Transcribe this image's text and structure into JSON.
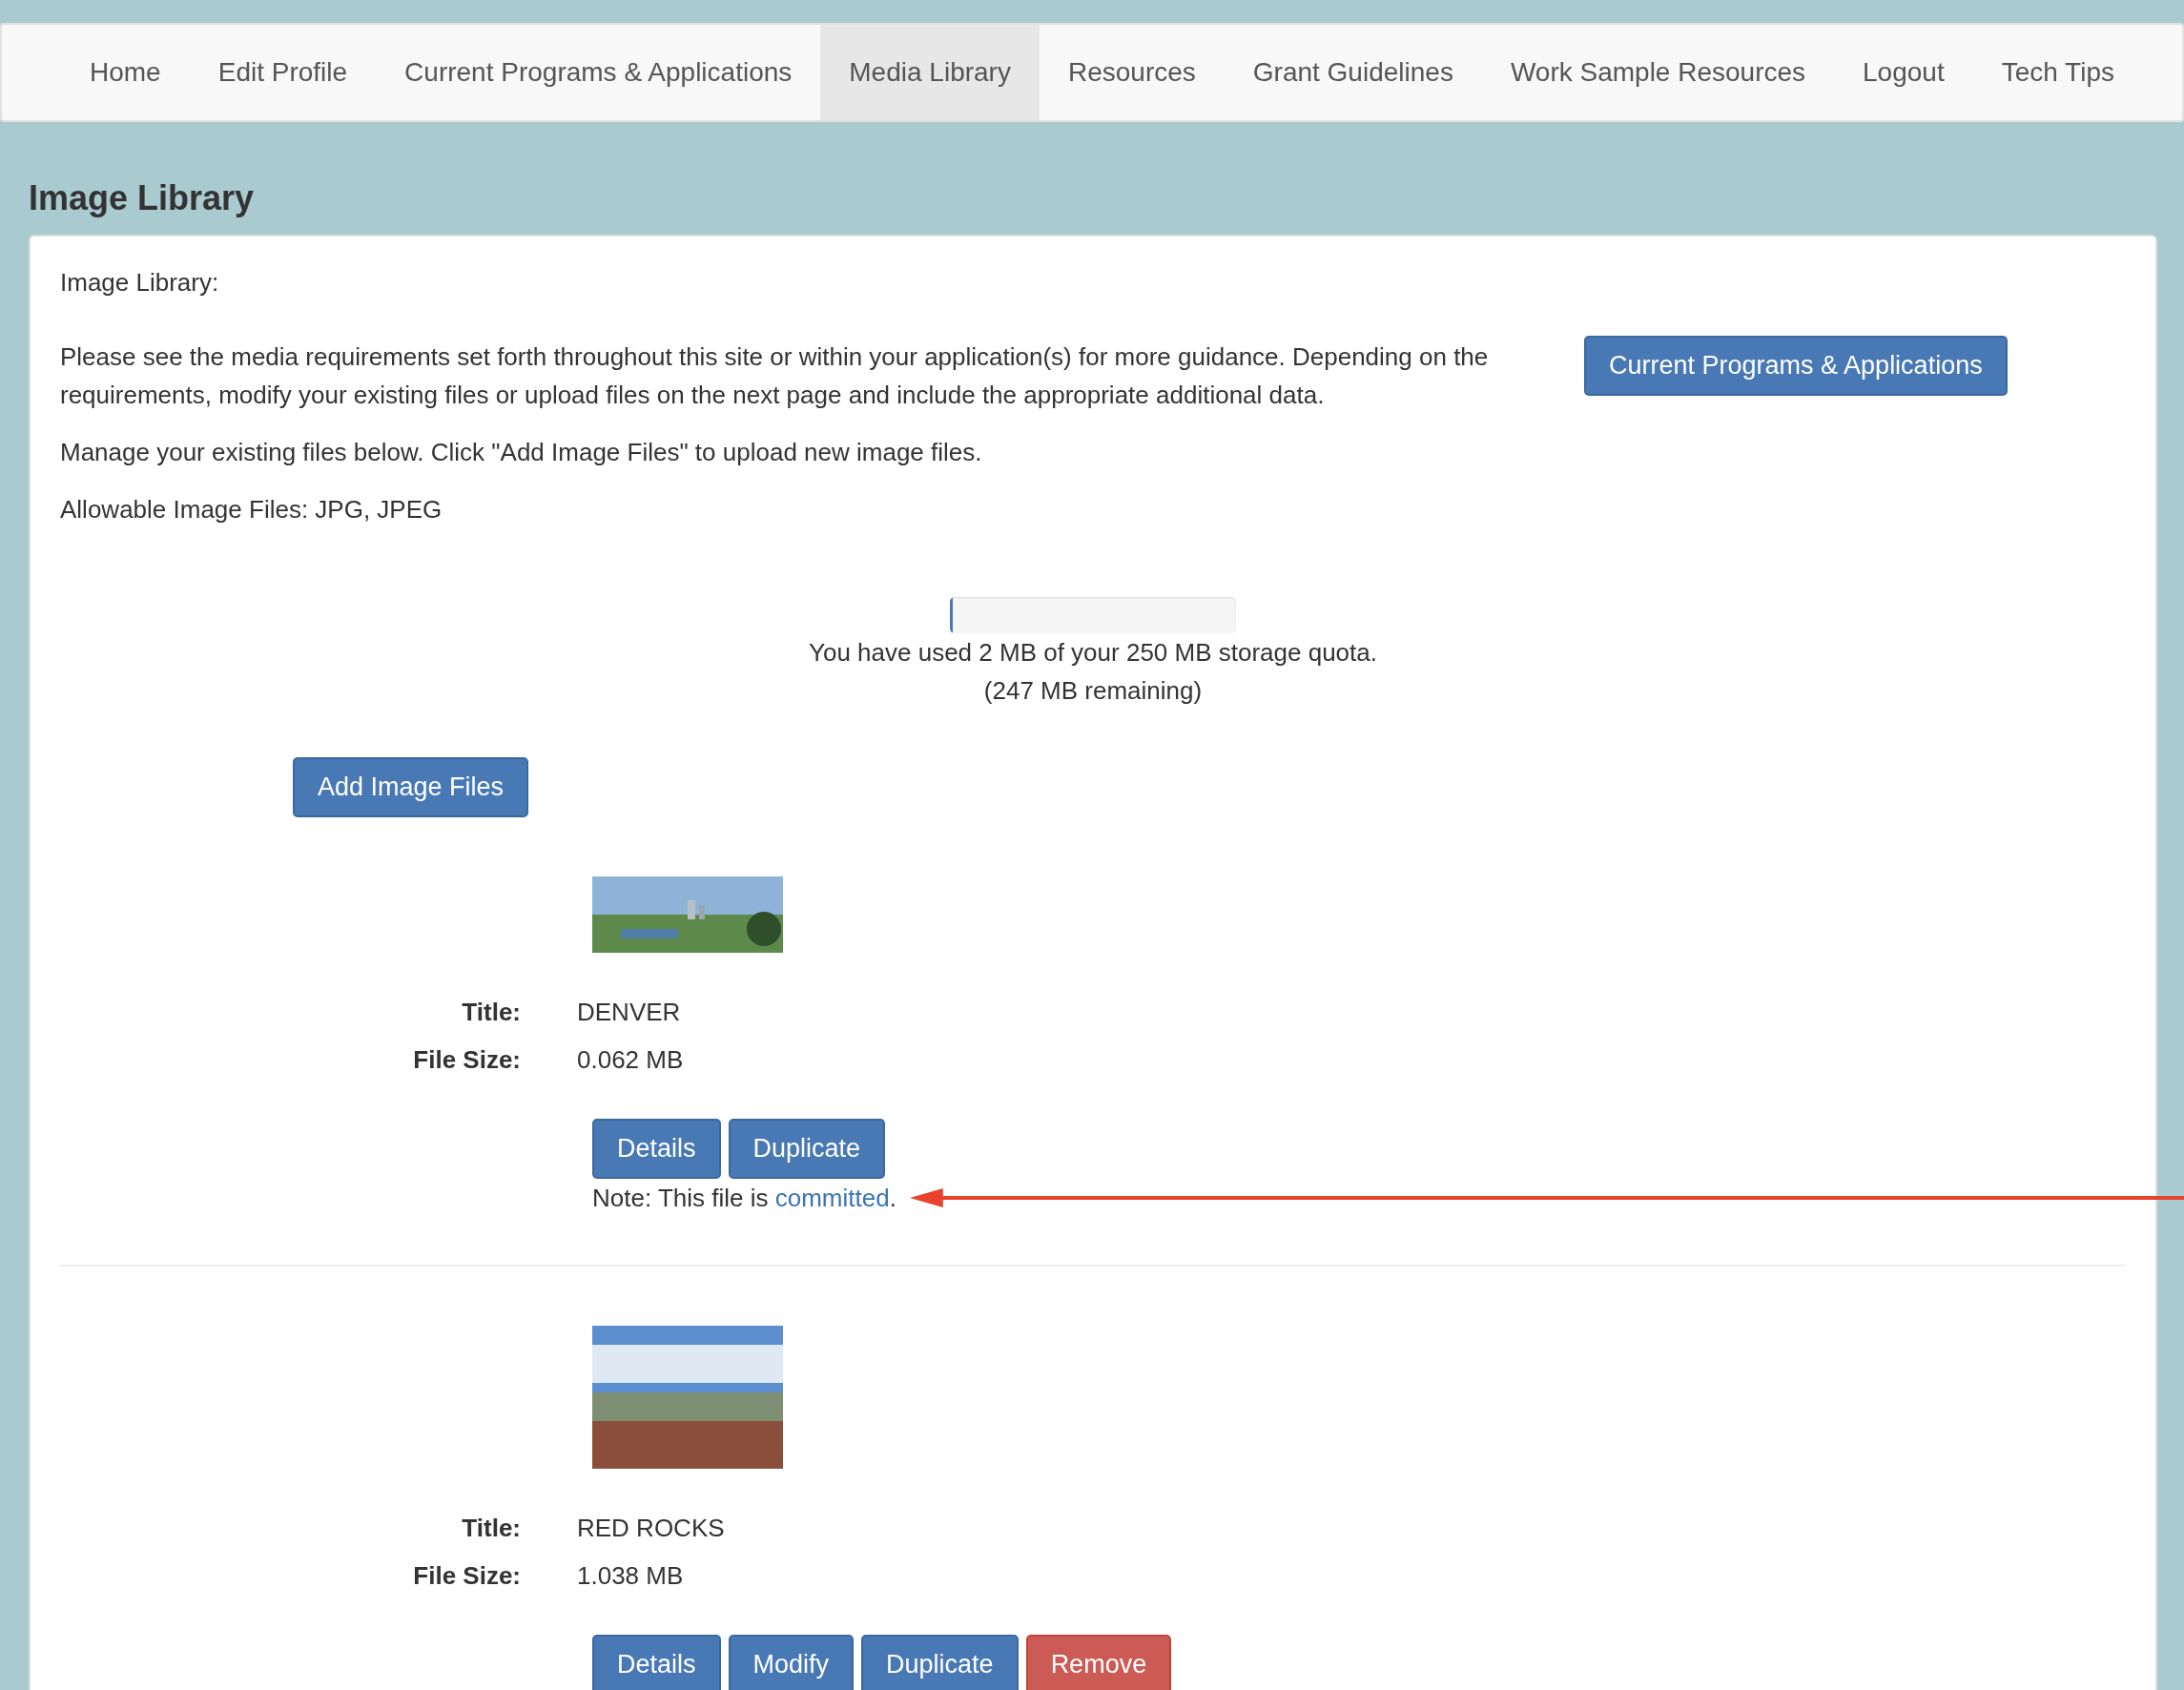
{
  "nav": {
    "items": [
      {
        "label": "Home",
        "selected": false
      },
      {
        "label": "Edit Profile",
        "selected": false
      },
      {
        "label": "Current Programs & Applications",
        "selected": false
      },
      {
        "label": "Media Library",
        "selected": true
      },
      {
        "label": "Resources",
        "selected": false
      },
      {
        "label": "Grant Guidelines",
        "selected": false
      },
      {
        "label": "Work Sample Resources",
        "selected": false
      },
      {
        "label": "Logout",
        "selected": false
      },
      {
        "label": "Tech Tips",
        "selected": false
      }
    ]
  },
  "page_title": "Image Library",
  "panel": {
    "heading": "Image Library:",
    "intro": "Please see the media requirements set forth throughout this site or within your application(s) for more guidance. Depending on the requirements, modify your existing files or upload files on the next page and include the appropriate additional data.",
    "programs_button": "Current Programs & Applications",
    "manage_text": "Manage your existing files below. Click \"Add Image Files\" to upload new image files.",
    "allowable_text": "Allowable Image Files: JPG, JPEG",
    "quota": {
      "level": 0.008,
      "used_text": "You have used 2 MB of your 250 MB storage quota.",
      "remaining_text": "(247 MB remaining)"
    },
    "add_button": "Add Image Files",
    "files": [
      {
        "kind": "skyline",
        "title_label": "Title:",
        "title": "DENVER",
        "size_label": "File Size:",
        "size": "0.062 MB",
        "buttons": [
          {
            "label": "Details",
            "kind": "primary"
          },
          {
            "label": "Duplicate",
            "kind": "primary"
          }
        ],
        "note": {
          "before": "Note: This file is ",
          "link": "committed",
          "after": "."
        },
        "arrow": true
      },
      {
        "kind": "canyon",
        "title_label": "Title:",
        "title": "RED ROCKS",
        "size_label": "File Size:",
        "size": "1.038 MB",
        "buttons": [
          {
            "label": "Details",
            "kind": "primary"
          },
          {
            "label": "Modify",
            "kind": "primary"
          },
          {
            "label": "Duplicate",
            "kind": "primary"
          },
          {
            "label": "Remove",
            "kind": "danger"
          }
        ]
      }
    ]
  }
}
